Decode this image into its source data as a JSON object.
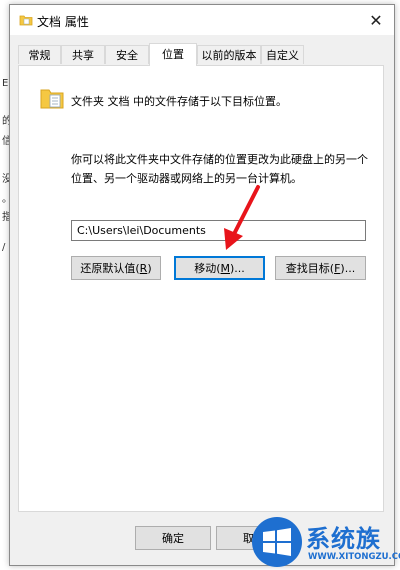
{
  "background_fragments": [
    "E",
    "的",
    "信",
    "没",
    "。",
    "指",
    "/"
  ],
  "window": {
    "title": "文档 属性",
    "close_glyph": "✕"
  },
  "tabs": [
    {
      "label": "常规",
      "active": false
    },
    {
      "label": "共享",
      "active": false
    },
    {
      "label": "安全",
      "active": false
    },
    {
      "label": "位置",
      "active": true
    },
    {
      "label": "以前的版本",
      "active": false
    },
    {
      "label": "自定义",
      "active": false
    }
  ],
  "location": {
    "info": "文件夹 文档 中的文件存储于以下目标位置。",
    "description_line1": "你可以将此文件夹中文件存储的位置更改为此硬盘上的另一个",
    "description_line2": "位置、另一个驱动器或网络上的另一台计算机。",
    "path": "C:\\Users\\lei\\Documents",
    "restore_label": "还原默认值(",
    "restore_key": "R",
    "move_label": "移动(",
    "move_key": "M",
    "find_label": "查找目标(",
    "find_key": "F",
    "suffix_close": ")",
    "suffix_ellipsis": ")..."
  },
  "footer": {
    "ok": "确定",
    "cancel": "取消"
  },
  "watermark": {
    "brand": "系统族",
    "url": "WWW.XITONGZU.COM"
  },
  "colors": {
    "arrow": "#e8141b",
    "focus": "#0078d7",
    "brand": "#1e6fd0",
    "folder": "#f5c842"
  }
}
